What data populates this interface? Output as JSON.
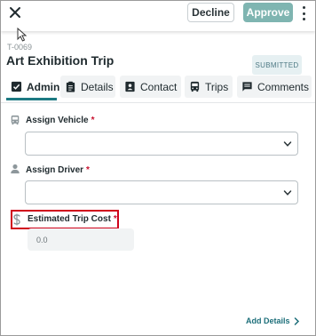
{
  "header": {
    "decline_label": "Decline",
    "approve_label": "Approve"
  },
  "trip": {
    "id": "T-0069",
    "title": "Art Exhibition Trip",
    "status": "SUBMITTED"
  },
  "tabs": [
    {
      "label": "Admin",
      "icon": "admin-check-icon",
      "active": true
    },
    {
      "label": "Details",
      "icon": "clipboard-icon",
      "active": false
    },
    {
      "label": "Contact",
      "icon": "contact-card-icon",
      "active": false
    },
    {
      "label": "Trips",
      "icon": "bus-icon",
      "active": false
    },
    {
      "label": "Comments",
      "icon": "comment-icon",
      "active": false
    }
  ],
  "form": {
    "vehicle": {
      "label": "Assign Vehicle",
      "required_mark": "*",
      "icon": "bus-icon",
      "value": ""
    },
    "driver": {
      "label": "Assign Driver",
      "required_mark": "*",
      "icon": "person-icon",
      "value": ""
    },
    "cost": {
      "label": "Estimated Trip Cost",
      "required_mark": "*",
      "icon": "dollar-icon",
      "value": "0.0"
    }
  },
  "footer": {
    "add_details_label": "Add Details"
  },
  "colors": {
    "accent": "#1d7a82",
    "approve_bg": "#7fb5b1",
    "required": "#c8102e",
    "highlight_border": "#d0021b"
  }
}
